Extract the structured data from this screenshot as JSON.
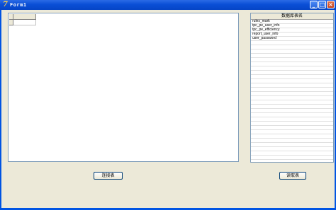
{
  "window": {
    "title": "Form1",
    "app_icon": "delphi-icon"
  },
  "titlebar_buttons": {
    "minimize": "_",
    "maximize": "□",
    "close": "×"
  },
  "table_list": {
    "header": "数据库表名",
    "rows": [
      "rules_mark",
      "tpc_pe_user_info",
      "tpc_pe_efficiency",
      "report_user_info",
      "user_password",
      "",
      "",
      "",
      "",
      "",
      "",
      "",
      "",
      "",
      "",
      "",
      "",
      "",
      "",
      "",
      "",
      "",
      "",
      "",
      "",
      "",
      "",
      "",
      "",
      "",
      "",
      "",
      ""
    ]
  },
  "buttons": {
    "connect": "连接表",
    "read": "读取表"
  }
}
